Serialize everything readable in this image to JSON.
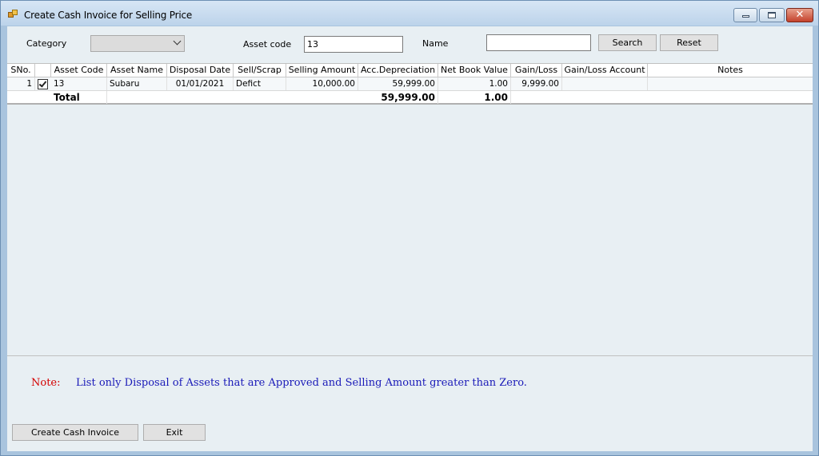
{
  "window": {
    "title": "Create Cash Invoice for Selling Price"
  },
  "filters": {
    "category_label": "Category",
    "category_value": "",
    "asset_code_label": "Asset code",
    "asset_code_value": "13",
    "name_label": "Name",
    "name_value": "",
    "search_label": "Search",
    "reset_label": "Reset"
  },
  "grid": {
    "columns": [
      "SNo.",
      "",
      "Asset Code",
      "Asset Name",
      "Disposal Date",
      "Sell/Scrap",
      "Selling Amount",
      "Acc.Depreciation",
      "Net Book Value",
      "Gain/Loss",
      "Gain/Loss Account",
      "Notes"
    ],
    "rows": [
      {
        "sno": "1",
        "checked": true,
        "asset_code": "13",
        "asset_name": "Subaru",
        "disposal_date": "01/01/2021",
        "sell_scrap": "Defict",
        "selling_amount": "10,000.00",
        "acc_depreciation": "59,999.00",
        "net_book_value": "1.00",
        "gain_loss": "9,999.00",
        "gain_loss_account": "",
        "notes": ""
      }
    ],
    "total": {
      "label": "Total",
      "acc_depreciation": "59,999.00",
      "net_book_value": "1.00"
    }
  },
  "note": {
    "label": "Note:",
    "text": "List only Disposal of Assets that are Approved and Selling Amount greater than Zero."
  },
  "actions": {
    "create_label": "Create Cash Invoice",
    "exit_label": "Exit"
  },
  "colors": {
    "note_label": "#d40000",
    "note_text": "#1a1ab8",
    "client_bg": "#e8eff3"
  }
}
